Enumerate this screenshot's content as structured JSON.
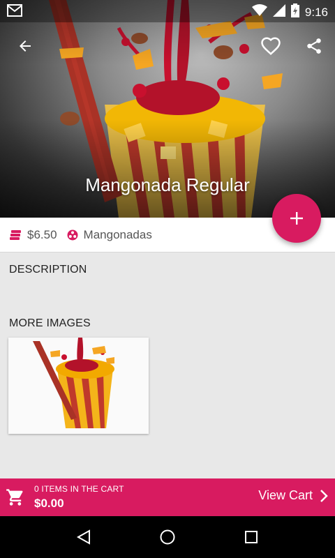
{
  "status_bar": {
    "time": "9:16",
    "icons": [
      "gmail-icon",
      "wifi-icon",
      "signal-icon",
      "battery-charging-icon"
    ]
  },
  "toolbar": {
    "back_icon": "arrow-back-icon",
    "favorite_icon": "heart-outline-icon",
    "share_icon": "share-icon"
  },
  "product": {
    "title": "Mangonada Regular",
    "price": "$6.50",
    "category": "Mangonadas"
  },
  "fab": {
    "icon": "plus-icon"
  },
  "sections": {
    "description": "DESCRIPTION",
    "more_images": "MORE IMAGES"
  },
  "cart": {
    "count_text": "0 ITEMS IN THE CART",
    "total": "$0.00",
    "view_label": "View Cart"
  },
  "colors": {
    "accent": "#d81b60",
    "background": "#e8e8e8"
  },
  "nav": [
    "back-triangle-icon",
    "home-circle-icon",
    "recents-square-icon"
  ]
}
